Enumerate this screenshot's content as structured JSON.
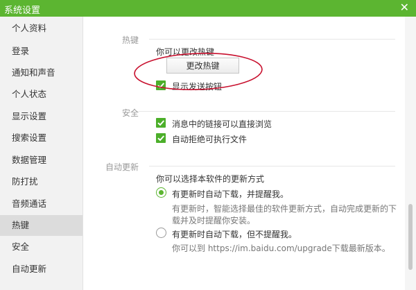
{
  "window": {
    "title": "系统设置",
    "close": "✕"
  },
  "sidebar": {
    "items": [
      {
        "label": "个人资料"
      },
      {
        "label": "登录"
      },
      {
        "label": "通知和声音"
      },
      {
        "label": "个人状态"
      },
      {
        "label": "显示设置"
      },
      {
        "label": "搜索设置"
      },
      {
        "label": "数据管理"
      },
      {
        "label": "防打扰"
      },
      {
        "label": "音频通话"
      },
      {
        "label": "热键",
        "active": true
      },
      {
        "label": "安全"
      },
      {
        "label": "自动更新"
      }
    ]
  },
  "hotkey": {
    "section_label": "热键",
    "description": "你可以更改热键",
    "change_button": "更改热键",
    "show_send_button_label": "显示发送按钮",
    "show_send_button_checked": true
  },
  "security": {
    "section_label": "安全",
    "options": [
      {
        "label": "消息中的链接可以直接浏览",
        "checked": true
      },
      {
        "label": "自动拒绝可执行文件",
        "checked": true
      }
    ]
  },
  "auto_update": {
    "section_label": "自动更新",
    "description": "你可以选择本软件的更新方式",
    "option1": {
      "label": "有更新时自动下载，并提醒我。",
      "detail_line1": "有更新时，智能选择最佳的软件更新方式，自动完成更新的下",
      "detail_line2": "载并及时提醒你安装。",
      "checked": true
    },
    "option2": {
      "label": "有更新时自动下载，但不提醒我。",
      "detail": "你可以到 https://im.baidu.com/upgrade下载最新版本。",
      "checked": false
    }
  },
  "colors": {
    "accent": "#5cb531",
    "annotation": "#c8102e"
  }
}
